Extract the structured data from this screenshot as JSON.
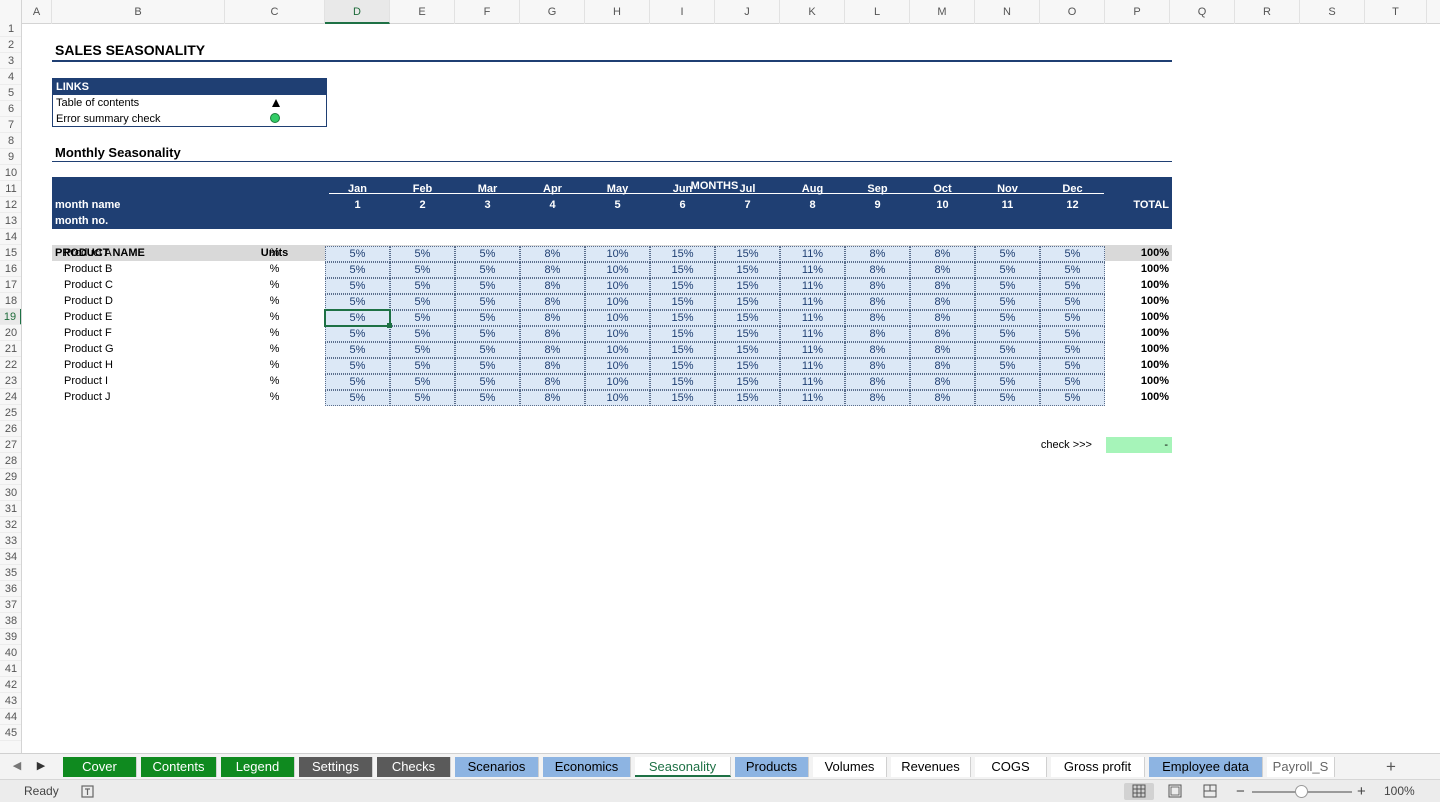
{
  "columns": [
    "A",
    "B",
    "C",
    "D",
    "E",
    "F",
    "G",
    "H",
    "I",
    "J",
    "K",
    "L",
    "M",
    "N",
    "O",
    "P",
    "Q",
    "R",
    "S",
    "T"
  ],
  "active_column": "D",
  "rows": [
    1,
    2,
    3,
    4,
    5,
    6,
    7,
    8,
    9,
    10,
    11,
    12,
    13,
    14,
    15,
    16,
    17,
    18,
    19,
    20,
    21,
    22,
    23,
    24,
    25,
    26,
    27,
    28,
    29,
    30,
    31,
    32,
    33,
    34,
    35,
    36,
    37,
    38,
    39,
    40,
    41,
    42,
    43,
    44,
    45
  ],
  "active_row": 19,
  "sheet_title": "SALES SEASONALITY",
  "links": {
    "header": "LINKS",
    "items": [
      {
        "label": "Table of contents",
        "icon": "triangle-up-icon"
      },
      {
        "label": "Error summary check",
        "icon": "green-circle-icon"
      }
    ]
  },
  "section_title": "Monthly Seasonality",
  "months_header": "MONTHS",
  "month_name_label": "month name",
  "month_no_label": "month no.",
  "total_label": "TOTAL",
  "months": [
    {
      "name": "Jan",
      "no": "1"
    },
    {
      "name": "Feb",
      "no": "2"
    },
    {
      "name": "Mar",
      "no": "3"
    },
    {
      "name": "Apr",
      "no": "4"
    },
    {
      "name": "May",
      "no": "5"
    },
    {
      "name": "Jun",
      "no": "6"
    },
    {
      "name": "Jul",
      "no": "7"
    },
    {
      "name": "Aug",
      "no": "8"
    },
    {
      "name": "Sep",
      "no": "9"
    },
    {
      "name": "Oct",
      "no": "10"
    },
    {
      "name": "Nov",
      "no": "11"
    },
    {
      "name": "Dec",
      "no": "12"
    }
  ],
  "product_header": "PRODUCT NAME",
  "units_header": "Units",
  "products": [
    {
      "name": "Product A",
      "unit": "%",
      "values": [
        "5%",
        "5%",
        "5%",
        "8%",
        "10%",
        "15%",
        "15%",
        "11%",
        "8%",
        "8%",
        "5%",
        "5%"
      ],
      "total": "100%"
    },
    {
      "name": "Product B",
      "unit": "%",
      "values": [
        "5%",
        "5%",
        "5%",
        "8%",
        "10%",
        "15%",
        "15%",
        "11%",
        "8%",
        "8%",
        "5%",
        "5%"
      ],
      "total": "100%"
    },
    {
      "name": "Product C",
      "unit": "%",
      "values": [
        "5%",
        "5%",
        "5%",
        "8%",
        "10%",
        "15%",
        "15%",
        "11%",
        "8%",
        "8%",
        "5%",
        "5%"
      ],
      "total": "100%"
    },
    {
      "name": "Product D",
      "unit": "%",
      "values": [
        "5%",
        "5%",
        "5%",
        "8%",
        "10%",
        "15%",
        "15%",
        "11%",
        "8%",
        "8%",
        "5%",
        "5%"
      ],
      "total": "100%"
    },
    {
      "name": "Product E",
      "unit": "%",
      "values": [
        "5%",
        "5%",
        "5%",
        "8%",
        "10%",
        "15%",
        "15%",
        "11%",
        "8%",
        "8%",
        "5%",
        "5%"
      ],
      "total": "100%"
    },
    {
      "name": "Product F",
      "unit": "%",
      "values": [
        "5%",
        "5%",
        "5%",
        "8%",
        "10%",
        "15%",
        "15%",
        "11%",
        "8%",
        "8%",
        "5%",
        "5%"
      ],
      "total": "100%"
    },
    {
      "name": "Product G",
      "unit": "%",
      "values": [
        "5%",
        "5%",
        "5%",
        "8%",
        "10%",
        "15%",
        "15%",
        "11%",
        "8%",
        "8%",
        "5%",
        "5%"
      ],
      "total": "100%"
    },
    {
      "name": "Product H",
      "unit": "%",
      "values": [
        "5%",
        "5%",
        "5%",
        "8%",
        "10%",
        "15%",
        "15%",
        "11%",
        "8%",
        "8%",
        "5%",
        "5%"
      ],
      "total": "100%"
    },
    {
      "name": "Product I",
      "unit": "%",
      "values": [
        "5%",
        "5%",
        "5%",
        "8%",
        "10%",
        "15%",
        "15%",
        "11%",
        "8%",
        "8%",
        "5%",
        "5%"
      ],
      "total": "100%"
    },
    {
      "name": "Product J",
      "unit": "%",
      "values": [
        "5%",
        "5%",
        "5%",
        "8%",
        "10%",
        "15%",
        "15%",
        "11%",
        "8%",
        "8%",
        "5%",
        "5%"
      ],
      "total": "100%"
    }
  ],
  "selected_product": "Product E",
  "selected_month": "Jan",
  "check_label": "check >>>",
  "check_value": "-",
  "tabs": [
    {
      "label": "Cover",
      "bg": "#0f8a1f",
      "fg": "#ffffff"
    },
    {
      "label": "Contents",
      "bg": "#0f8a1f",
      "fg": "#ffffff"
    },
    {
      "label": "Legend",
      "bg": "#0f8a1f",
      "fg": "#ffffff"
    },
    {
      "label": "Settings",
      "bg": "#5a5a5a",
      "fg": "#ffffff"
    },
    {
      "label": "Checks",
      "bg": "#5a5a5a",
      "fg": "#ffffff"
    },
    {
      "label": "Scenarios",
      "bg": "#8db4e2",
      "fg": "#000000"
    },
    {
      "label": "Economics",
      "bg": "#8db4e2",
      "fg": "#000000"
    },
    {
      "label": "Seasonality",
      "bg": "#ffffff",
      "fg": "#1e7145",
      "active": true
    },
    {
      "label": "Products",
      "bg": "#8db4e2",
      "fg": "#000000"
    },
    {
      "label": "Volumes",
      "bg": "#ffffff",
      "fg": "#000000"
    },
    {
      "label": "Revenues",
      "bg": "#ffffff",
      "fg": "#000000"
    },
    {
      "label": "COGS",
      "bg": "#ffffff",
      "fg": "#000000"
    },
    {
      "label": "Gross profit",
      "bg": "#ffffff",
      "fg": "#000000"
    },
    {
      "label": "Employee data",
      "bg": "#8db4e2",
      "fg": "#000000"
    },
    {
      "label": "Payroll_S",
      "bg": "#ffffff",
      "fg": "#666666"
    }
  ],
  "status": {
    "ready": "Ready",
    "zoom": "100%"
  },
  "colors": {
    "navy": "#1f3f73",
    "input_fill": "#dce8f6",
    "check_fill": "#a6f4b9",
    "accent": "#1e7145"
  }
}
